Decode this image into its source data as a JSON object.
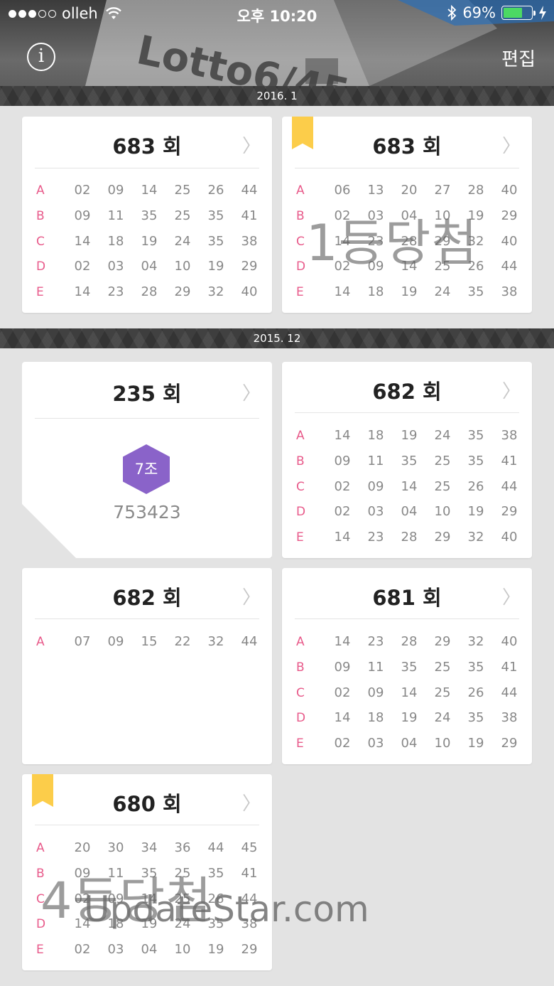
{
  "status_bar": {
    "carrier": "olleh",
    "time": "오후 10:20",
    "battery": "69%",
    "battery_level": 0.69
  },
  "header": {
    "info_icon": "info-icon",
    "edit_label": "편집",
    "photo_text": "Lotto6/45"
  },
  "months": [
    "2016. 1",
    "2015. 12"
  ],
  "cards": [
    {
      "title": "683 회",
      "bookmark": false,
      "stamp": "",
      "rows": [
        {
          "label": "A",
          "numbers": [
            "02",
            "09",
            "14",
            "25",
            "26",
            "44"
          ]
        },
        {
          "label": "B",
          "numbers": [
            "09",
            "11",
            "35",
            "25",
            "35",
            "41"
          ]
        },
        {
          "label": "C",
          "numbers": [
            "14",
            "18",
            "19",
            "24",
            "35",
            "38"
          ]
        },
        {
          "label": "D",
          "numbers": [
            "02",
            "03",
            "04",
            "10",
            "19",
            "29"
          ]
        },
        {
          "label": "E",
          "numbers": [
            "14",
            "23",
            "28",
            "29",
            "32",
            "40"
          ]
        }
      ]
    },
    {
      "title": "683 회",
      "bookmark": true,
      "stamp": "1등당첨",
      "rows": [
        {
          "label": "A",
          "numbers": [
            "06",
            "13",
            "20",
            "27",
            "28",
            "40"
          ]
        },
        {
          "label": "B",
          "numbers": [
            "02",
            "03",
            "04",
            "10",
            "19",
            "29"
          ]
        },
        {
          "label": "C",
          "numbers": [
            "14",
            "23",
            "28",
            "29",
            "32",
            "40"
          ]
        },
        {
          "label": "D",
          "numbers": [
            "02",
            "09",
            "14",
            "25",
            "26",
            "44"
          ]
        },
        {
          "label": "E",
          "numbers": [
            "14",
            "18",
            "19",
            "24",
            "35",
            "38"
          ]
        }
      ]
    },
    {
      "title": "235 회",
      "type": "pension",
      "badge": "7조",
      "prize_number": "753423"
    },
    {
      "title": "682 회",
      "bookmark": false,
      "stamp": "",
      "rows": [
        {
          "label": "A",
          "numbers": [
            "14",
            "18",
            "19",
            "24",
            "35",
            "38"
          ]
        },
        {
          "label": "B",
          "numbers": [
            "09",
            "11",
            "35",
            "25",
            "35",
            "41"
          ]
        },
        {
          "label": "C",
          "numbers": [
            "02",
            "09",
            "14",
            "25",
            "26",
            "44"
          ]
        },
        {
          "label": "D",
          "numbers": [
            "02",
            "03",
            "04",
            "10",
            "19",
            "29"
          ]
        },
        {
          "label": "E",
          "numbers": [
            "14",
            "23",
            "28",
            "29",
            "32",
            "40"
          ]
        }
      ]
    },
    {
      "title": "682 회",
      "bookmark": false,
      "stamp": "",
      "rows": [
        {
          "label": "A",
          "numbers": [
            "07",
            "09",
            "15",
            "22",
            "32",
            "44"
          ]
        }
      ]
    },
    {
      "title": "681 회",
      "bookmark": false,
      "stamp": "",
      "rows": [
        {
          "label": "A",
          "numbers": [
            "14",
            "23",
            "28",
            "29",
            "32",
            "40"
          ]
        },
        {
          "label": "B",
          "numbers": [
            "09",
            "11",
            "35",
            "25",
            "35",
            "41"
          ]
        },
        {
          "label": "C",
          "numbers": [
            "02",
            "09",
            "14",
            "25",
            "26",
            "44"
          ]
        },
        {
          "label": "D",
          "numbers": [
            "14",
            "18",
            "19",
            "24",
            "35",
            "38"
          ]
        },
        {
          "label": "E",
          "numbers": [
            "02",
            "03",
            "04",
            "10",
            "19",
            "29"
          ]
        }
      ]
    },
    {
      "title": "680 회",
      "bookmark": true,
      "stamp": "4등당첨",
      "rows": [
        {
          "label": "A",
          "numbers": [
            "20",
            "30",
            "34",
            "36",
            "44",
            "45"
          ]
        },
        {
          "label": "B",
          "numbers": [
            "09",
            "11",
            "35",
            "25",
            "35",
            "41"
          ]
        },
        {
          "label": "C",
          "numbers": [
            "02",
            "09",
            "14",
            "25",
            "26",
            "44"
          ]
        },
        {
          "label": "D",
          "numbers": [
            "14",
            "18",
            "19",
            "24",
            "35",
            "38"
          ]
        },
        {
          "label": "E",
          "numbers": [
            "02",
            "03",
            "04",
            "10",
            "19",
            "29"
          ]
        }
      ]
    }
  ],
  "watermark": "UpdateStar.com",
  "colors": {
    "row_label": "#e85a8a",
    "bookmark": "#fccd4a",
    "badge": "#8a63c9",
    "background": "#e3e3e3"
  }
}
